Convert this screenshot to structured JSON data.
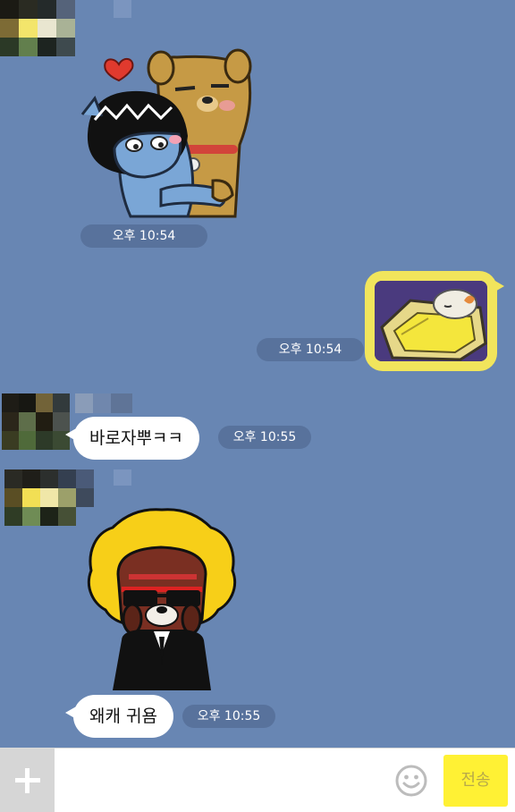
{
  "messages": [
    {
      "kind": "sticker",
      "side": "left",
      "sticker": "cat-and-dog-hug-sticker",
      "time": "오후 10:54"
    },
    {
      "kind": "image",
      "side": "right",
      "image": "sleeping-character-photo",
      "time": "오후 10:54"
    },
    {
      "kind": "text",
      "side": "left",
      "text": "바로자뿌ㅋㅋ",
      "time": "오후 10:55"
    },
    {
      "kind": "sticker",
      "side": "left",
      "sticker": "afro-character-sticker"
    },
    {
      "kind": "text",
      "side": "left",
      "text": "왜캐 귀욤",
      "time": "오후 10:55"
    }
  ],
  "input": {
    "placeholder": "",
    "send_label": "전송"
  },
  "colors": {
    "background": "#6886b3",
    "time_pill": "#58729c",
    "own_bubble": "#f1e55c",
    "send_button": "#fff134"
  }
}
